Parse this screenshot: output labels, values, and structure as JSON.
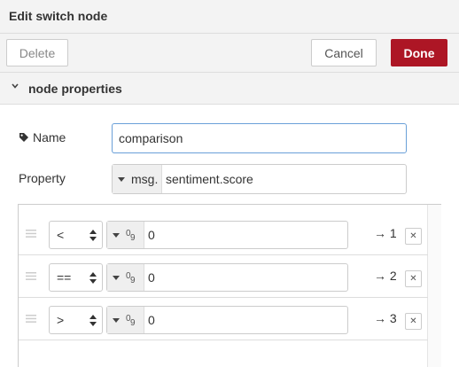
{
  "tray": {
    "title": "Edit switch node"
  },
  "toolbar": {
    "delete_label": "Delete",
    "cancel_label": "Cancel",
    "done_label": "Done"
  },
  "section": {
    "title": "node properties",
    "icon": "chevron-down-icon"
  },
  "form": {
    "name_label": "Name",
    "name_icon": "tag-icon",
    "name_value": "comparison",
    "property_label": "Property",
    "property_type": "msg.",
    "property_value": "sentiment.score"
  },
  "rules": [
    {
      "operator": "<",
      "value_type_icon": "number-type-icon",
      "value_type_glyph_zero": "0",
      "value_type_glyph_nine": "9",
      "value": "0",
      "output": "→ 1",
      "remove": "✕"
    },
    {
      "operator": "==",
      "value_type_icon": "number-type-icon",
      "value_type_glyph_zero": "0",
      "value_type_glyph_nine": "9",
      "value": "0",
      "output": "→ 2",
      "remove": "✕"
    },
    {
      "operator": ">",
      "value_type_icon": "number-type-icon",
      "value_type_glyph_zero": "0",
      "value_type_glyph_nine": "9",
      "value": "0",
      "output": "→ 3",
      "remove": "✕"
    }
  ],
  "colors": {
    "done_button": "#ad1625",
    "focused_border": "#6aa0d8",
    "header_bg": "#f3f3f3"
  }
}
